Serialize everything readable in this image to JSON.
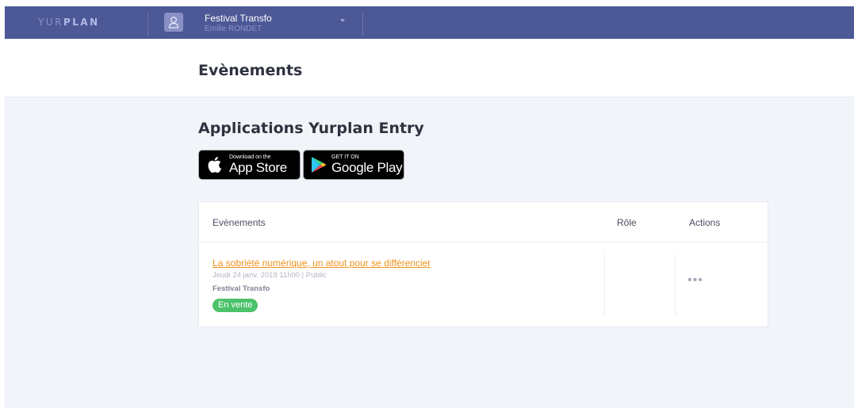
{
  "topbar": {
    "logo_light": "YUR",
    "logo_bold": "PLAN",
    "organization": "Festival Transfo",
    "user": "Emilie RONDET"
  },
  "header": {
    "title": "Evènements"
  },
  "apps": {
    "title": "Applications Yurplan Entry",
    "app_store": {
      "small": "Download on the",
      "big": "App Store"
    },
    "google_play": {
      "small": "GET IT ON",
      "big": "Google Play"
    }
  },
  "table": {
    "columns": [
      "Evènements",
      "Rôle",
      "Actions"
    ],
    "rows": [
      {
        "title": "La sobriété numérique, un atout pour se différencier",
        "date": "Jeudi 24 janv. 2019 11h00 | Public",
        "organizer": "Festival Transfo",
        "status": "En vente",
        "actions": "•••"
      }
    ]
  },
  "colors": {
    "topbar": "#4d5996",
    "link": "#f0921e",
    "badge": "#4cc26a",
    "background": "#f1f4f9"
  },
  "icons": [
    "user-icon",
    "chevron-down-icon",
    "apple-icon",
    "google-play-icon",
    "more-icon"
  ]
}
